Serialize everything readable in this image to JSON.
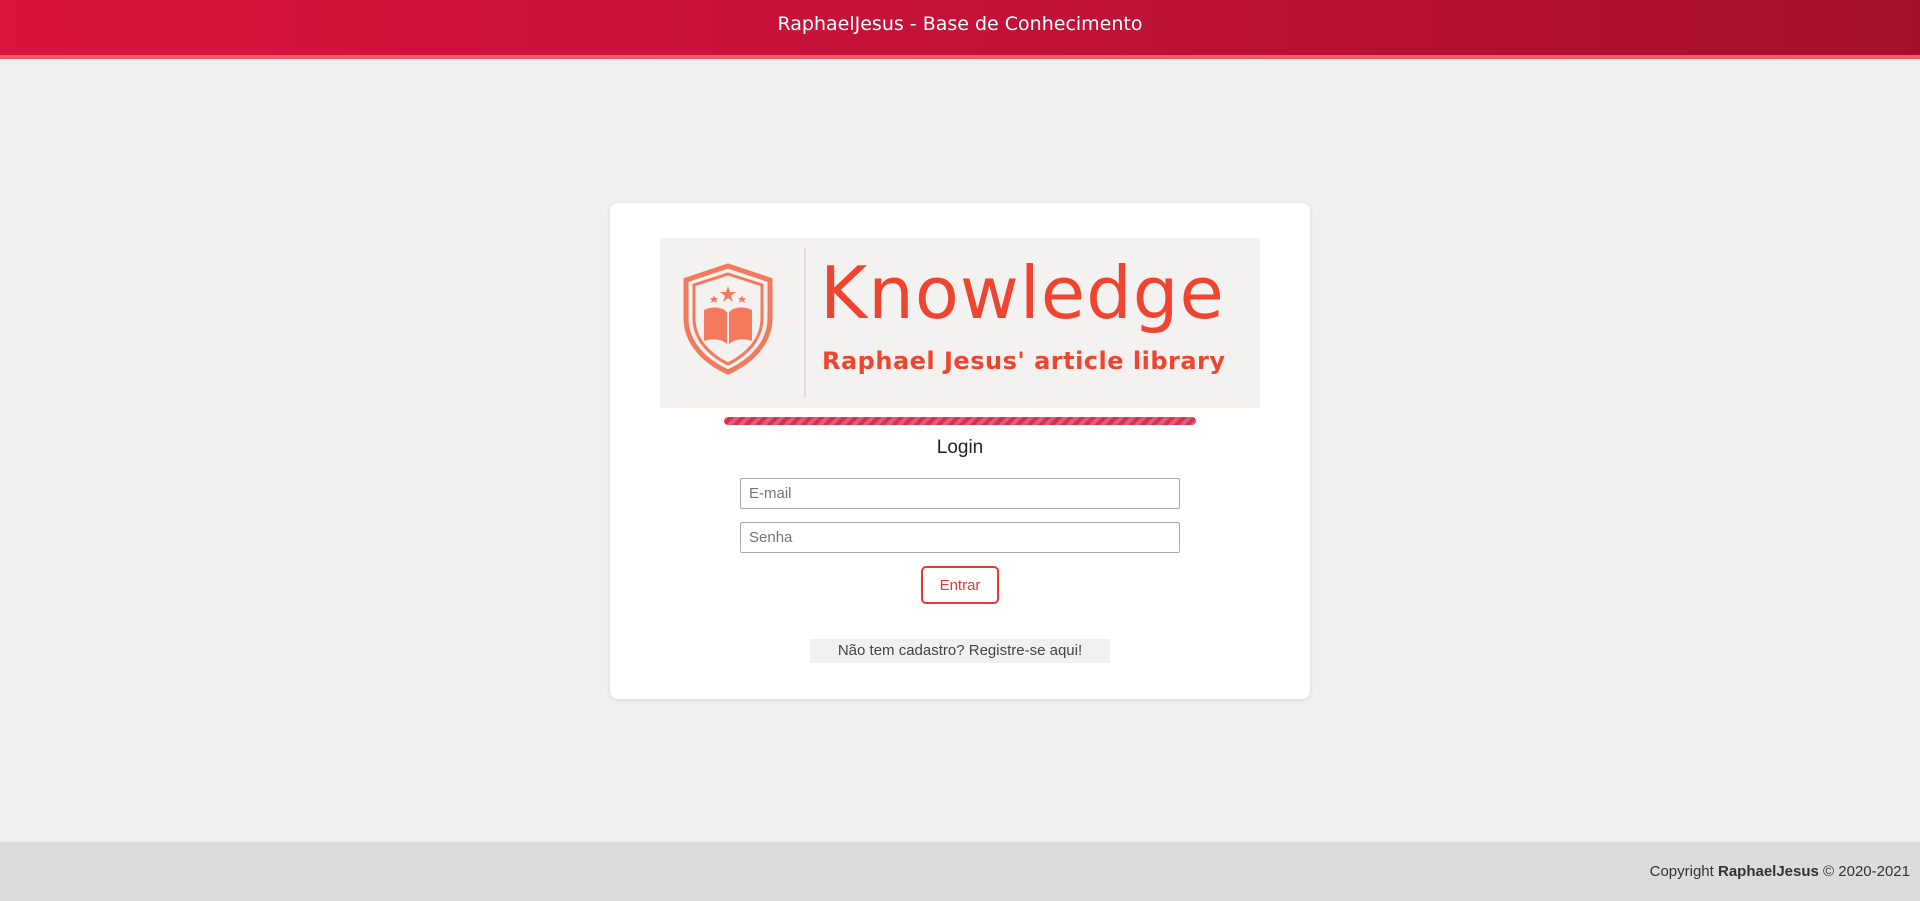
{
  "header": {
    "title": "RaphaelJesus - Base de Conhecimento"
  },
  "logo": {
    "brand": "Knowledge",
    "tagline": "Raphael Jesus' article library",
    "icon": "shield-book-icon",
    "color": "#ef4530"
  },
  "progress": {
    "state": "indeterminate"
  },
  "login": {
    "title": "Login",
    "email_placeholder": "E-mail",
    "password_placeholder": "Senha",
    "email_value": "",
    "password_value": "",
    "submit_label": "Entrar",
    "register_label": "Não tem cadastro? Registre-se aqui!"
  },
  "footer": {
    "prefix": "Copyright ",
    "owner": "RaphaelJesus",
    "suffix": " © 2020-2021"
  },
  "colors": {
    "header_start": "#d9143e",
    "header_end": "#a50f2d",
    "accent": "#e53935",
    "background": "#efefef"
  }
}
